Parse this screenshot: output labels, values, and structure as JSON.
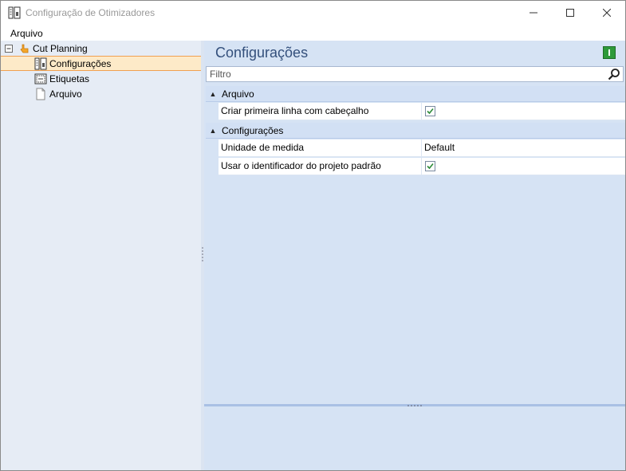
{
  "window": {
    "title": "Configuração de Otimizadores",
    "controls": {
      "minimize": "—",
      "maximize": "☐",
      "close": "✕"
    }
  },
  "menu": {
    "items": [
      {
        "label": "Arquivo"
      }
    ]
  },
  "tree": {
    "root": {
      "label": "Cut Planning",
      "expander": "⊟",
      "icon": "hand-pointer-icon"
    },
    "items": [
      {
        "label": "Configurações",
        "icon": "config-icon",
        "selected": true
      },
      {
        "label": "Etiquetas",
        "icon": "labels-icon",
        "selected": false
      },
      {
        "label": "Arquivo",
        "icon": "document-icon",
        "selected": false
      }
    ]
  },
  "panel": {
    "title": "Configurações",
    "filter_placeholder": "Filtro",
    "categories": [
      {
        "label": "Arquivo",
        "properties": [
          {
            "name": "Criar primeira linha com cabeçalho",
            "type": "checkbox",
            "checked": true
          }
        ]
      },
      {
        "label": "Configurações",
        "properties": [
          {
            "name": "Unidade de medida",
            "type": "text",
            "value": "Default"
          },
          {
            "name": "Usar o identificador do projeto padrão",
            "type": "checkbox",
            "checked": true
          }
        ]
      }
    ]
  },
  "colors": {
    "selected_bg": "#fdeac8",
    "selected_border": "#f0a050",
    "panel_bg": "#d6e3f4",
    "title": "#34507c",
    "check": "#2e8b3a"
  }
}
